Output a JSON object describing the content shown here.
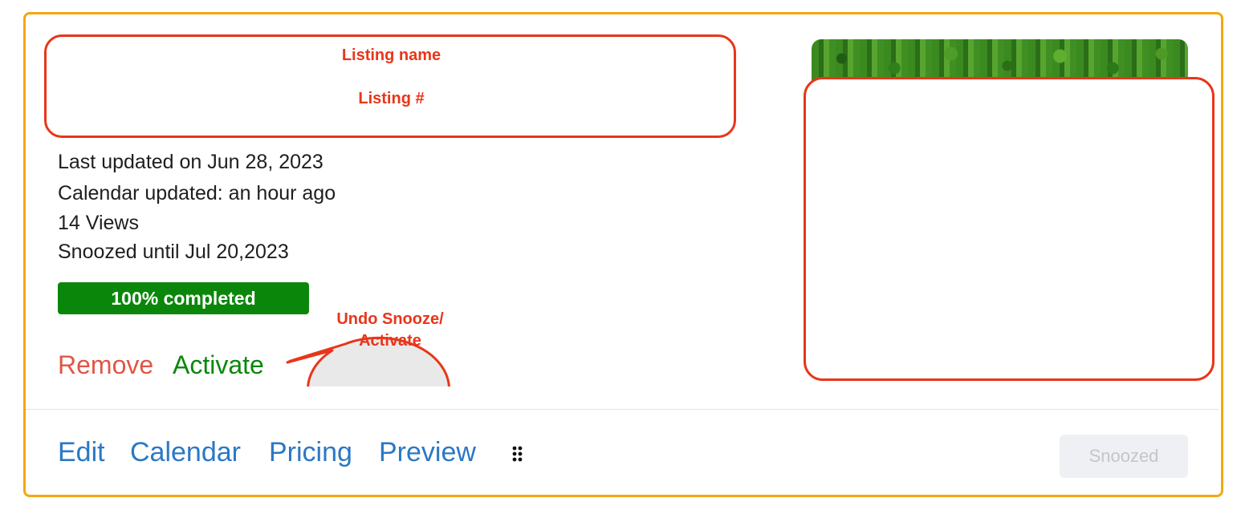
{
  "callouts": {
    "listing_name": "Listing name",
    "listing_number": "Listing #",
    "undo_snooze": "Undo Snooze/\nActivate"
  },
  "listing": {
    "last_updated": "Last updated on Jun 28, 2023",
    "calendar_updated": "Calendar updated: an hour ago",
    "views": "14 Views",
    "snoozed_until": "Snoozed until Jul 20,2023",
    "progress_label": "100% completed",
    "progress_percent": 100
  },
  "actions": {
    "remove": "Remove",
    "activate": "Activate"
  },
  "footer": {
    "edit": "Edit",
    "calendar": "Calendar",
    "pricing": "Pricing",
    "preview": "Preview",
    "status_button": "Snoozed",
    "drag_icon": "drag-handle-icon"
  },
  "colors": {
    "card_border": "#f5a70f",
    "callout_red": "#e8361a",
    "remove_red": "#e05646",
    "activate_green": "#0b870b",
    "progress_green": "#0a870a",
    "link_blue": "#2b78c5",
    "disabled_button_bg": "#eef0f3"
  }
}
